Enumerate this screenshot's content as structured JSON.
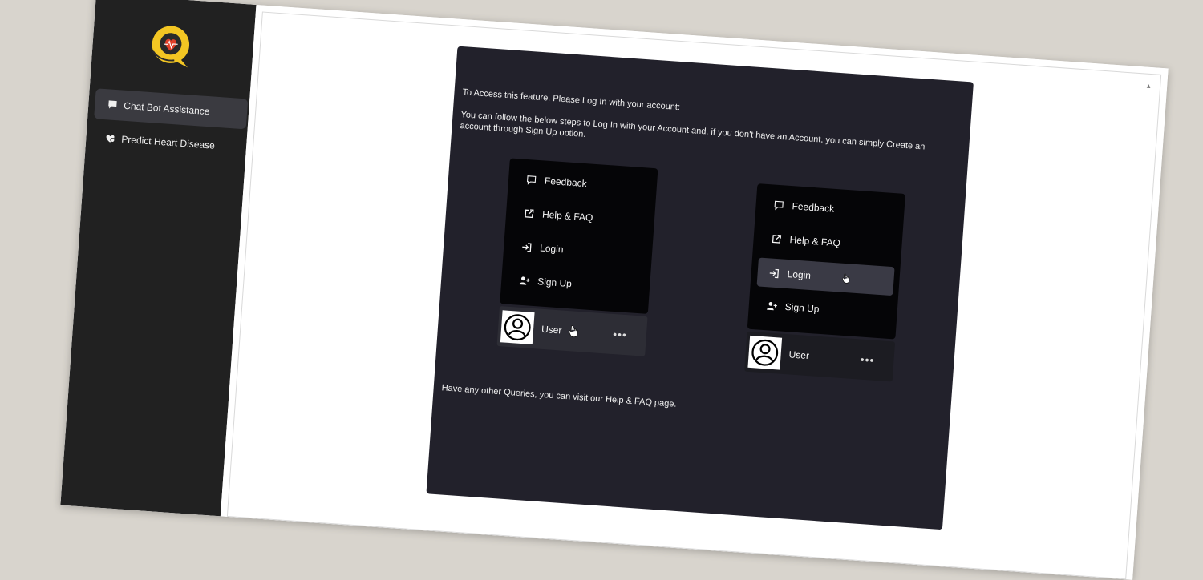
{
  "sidebar": {
    "items": [
      {
        "label": "Chat Bot Assistance",
        "icon": "chat-icon",
        "active": true
      },
      {
        "label": "Predict Heart Disease",
        "icon": "heart-icon",
        "active": false
      }
    ]
  },
  "card": {
    "intro": "To Access this feature, Please Log In with your account:",
    "instructions": "You can follow the below steps to Log In with your Account and, if you don't have an Account, you can simply Create an account through Sign Up option.",
    "footer": "Have any other Queries, you can visit our Help & FAQ page."
  },
  "menu": {
    "items": [
      {
        "label": "Feedback",
        "icon": "feedback-icon"
      },
      {
        "label": "Help & FAQ",
        "icon": "external-link-icon"
      },
      {
        "label": "Login",
        "icon": "login-icon"
      },
      {
        "label": "Sign Up",
        "icon": "add-user-icon"
      }
    ],
    "user_label": "User",
    "more_label": "•••"
  },
  "colors": {
    "sidebar_bg": "#212121",
    "card_bg": "#22212b",
    "logo_accent": "#f3c623",
    "heart": "#e0402a"
  }
}
